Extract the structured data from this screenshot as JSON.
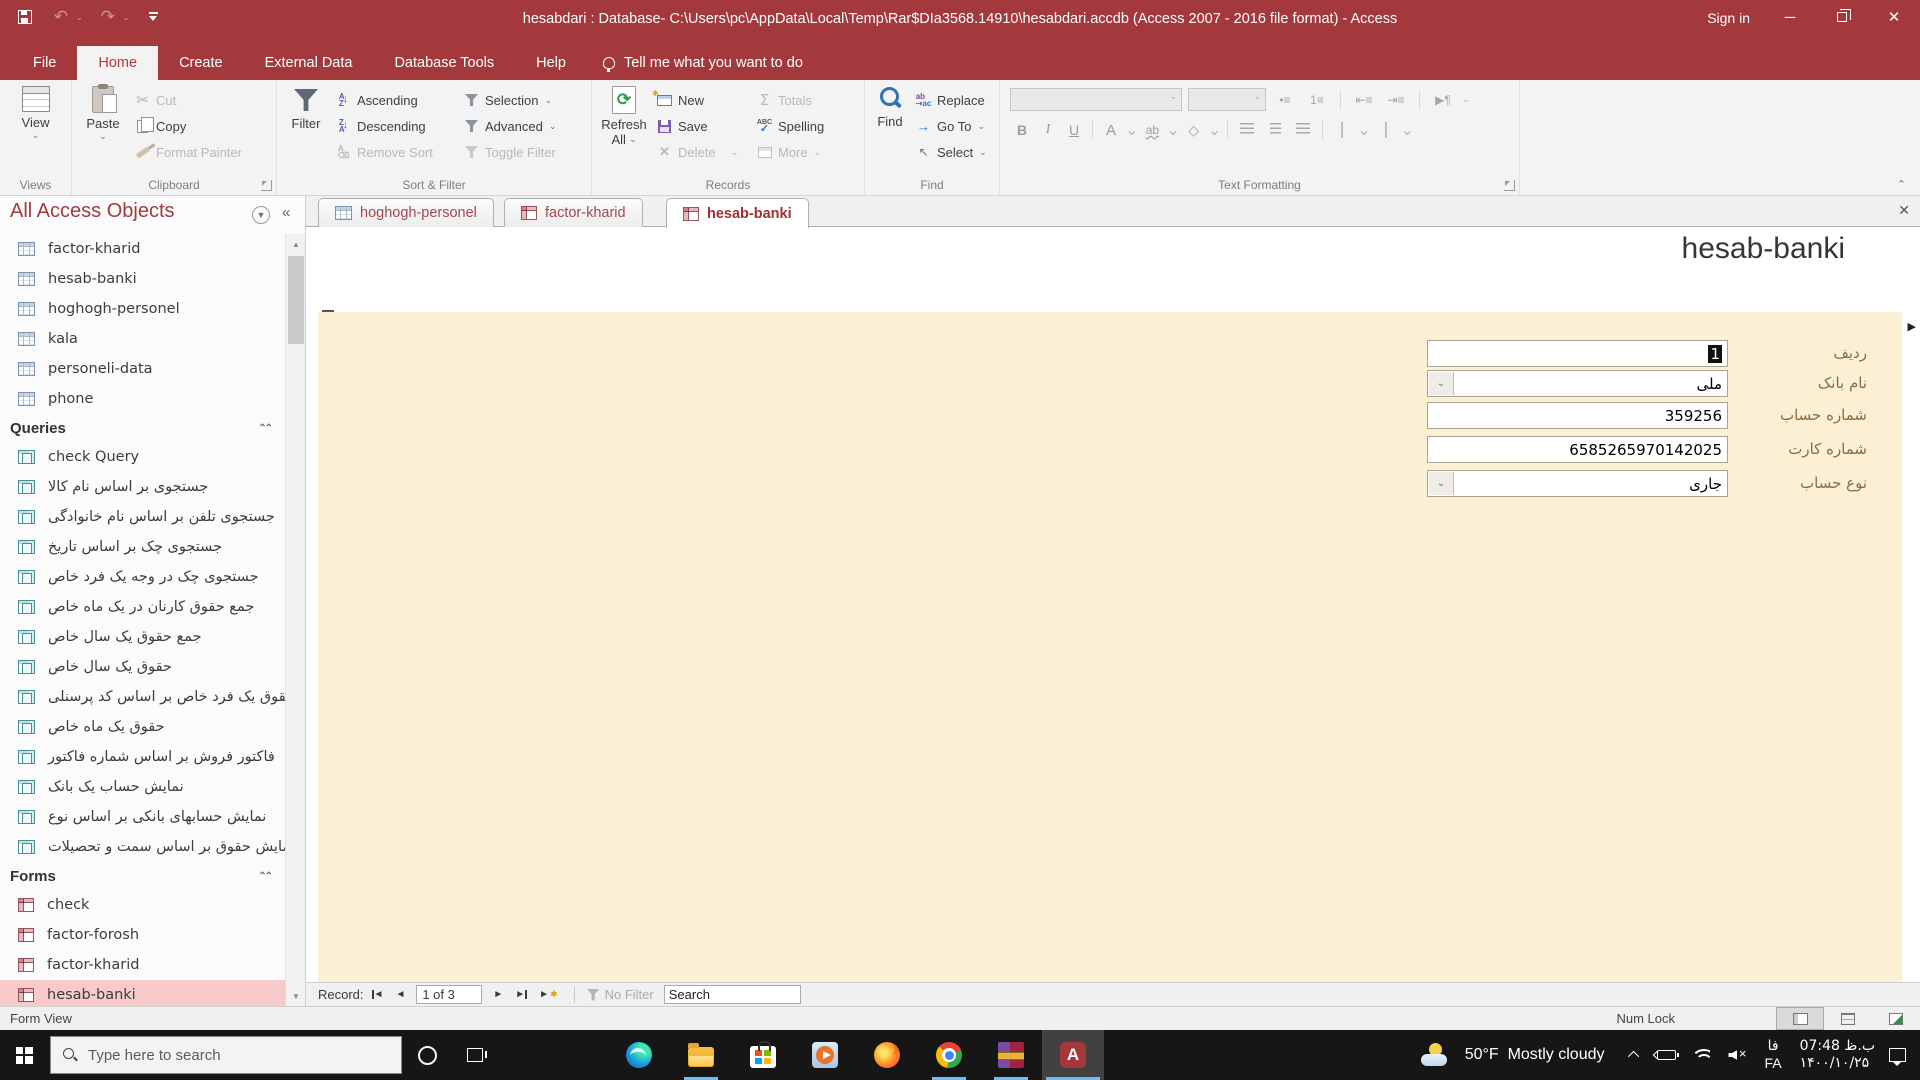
{
  "titlebar": {
    "title": "hesabdari : Database- C:\\Users\\pc\\AppData\\Local\\Temp\\Rar$DIa3568.14910\\hesabdari.accdb (Access 2007 - 2016 file format)  -  Access",
    "sign_in": "Sign in"
  },
  "menu": {
    "items": [
      {
        "label": "File",
        "active": false
      },
      {
        "label": "Home",
        "active": true
      },
      {
        "label": "Create",
        "active": false
      },
      {
        "label": "External Data",
        "active": false
      },
      {
        "label": "Database Tools",
        "active": false
      },
      {
        "label": "Help",
        "active": false
      }
    ],
    "tell_me": "Tell me what you want to do"
  },
  "ribbon": {
    "groups": {
      "views": "Views",
      "clipboard": "Clipboard",
      "sort_filter": "Sort & Filter",
      "records": "Records",
      "find": "Find",
      "text_formatting": "Text Formatting"
    },
    "buttons": {
      "view": "View",
      "paste": "Paste",
      "cut": "Cut",
      "copy": "Copy",
      "format_painter": "Format Painter",
      "filter": "Filter",
      "ascending": "Ascending",
      "descending": "Descending",
      "remove_sort": "Remove Sort",
      "selection": "Selection",
      "advanced": "Advanced",
      "toggle_filter": "Toggle Filter",
      "refresh": "Refresh",
      "refresh_all": "All",
      "new": "New",
      "save": "Save",
      "delete": "Delete",
      "totals": "Totals",
      "spelling": "Spelling",
      "more": "More",
      "find": "Find",
      "replace": "Replace",
      "go_to": "Go To",
      "select": "Select"
    },
    "tf_glyphs": {
      "bold": "B",
      "italic": "I",
      "underline": "U",
      "font_color": "A",
      "highlight": "ab",
      "fill": "◇",
      "direction": "▶¶",
      "bullets": "•≡",
      "numbering": "1≡",
      "outdent": "⇤≡",
      "indent": "⇥≡"
    }
  },
  "nav_pane": {
    "title": "All Access Objects",
    "sections": [
      {
        "header": null,
        "type": "table",
        "items": [
          "factor-kharid",
          "hesab-banki",
          "hoghogh-personel",
          "kala",
          "personeli-data",
          "phone"
        ]
      },
      {
        "header": "Queries",
        "type": "query",
        "items": [
          "check Query",
          "جستجوی بر اساس نام کالا",
          "جستجوی تلفن بر اساس نام خانوادگی",
          "جستجوی چک بر اساس تاریخ",
          "جستجوی چک در وجه یک فرد خاص",
          "جمع حقوق کارنان در یک ماه خاص",
          "جمع حقوق یک سال خاص",
          "حقوق یک سال خاص",
          "حقوق یک فرد خاص بر اساس کد پرسنلی",
          "حقوق یک ماه خاص",
          "فاکتور فروش بر اساس شماره فاکتور",
          "نمایش حساب یک بانک",
          "نمایش حسابهای بانکی بر اساس نوع",
          "نمایش حقوق بر اساس سمت و تحصیلات"
        ]
      },
      {
        "header": "Forms",
        "type": "form",
        "items": [
          "check",
          "factor-forosh",
          "factor-kharid",
          "hesab-banki"
        ],
        "selected": "hesab-banki"
      }
    ]
  },
  "tabs": [
    {
      "label": "hoghogh-personel",
      "type": "table",
      "active": false
    },
    {
      "label": "factor-kharid",
      "type": "form",
      "active": false
    },
    {
      "label": "hesab-banki",
      "type": "form",
      "active": true
    }
  ],
  "form": {
    "title": "hesab-banki",
    "fields": [
      {
        "label": "ردیف",
        "value": "1",
        "type": "text",
        "selected": true
      },
      {
        "label": "نام بانک",
        "value": "ملی",
        "type": "combo",
        "selected": false
      },
      {
        "label": "شماره حساب",
        "value": "359256",
        "type": "text",
        "selected": false
      },
      {
        "label": "شماره کارت",
        "value": "6585265970142025",
        "type": "text",
        "selected": false
      },
      {
        "label": "نوع حساب",
        "value": "جاری",
        "type": "combo",
        "selected": false
      }
    ]
  },
  "record_nav": {
    "record_label": "Record:",
    "position": "1 of 3",
    "no_filter": "No Filter",
    "search_placeholder": "Search"
  },
  "status_bar": {
    "left": "Form View",
    "num_lock": "Num Lock"
  },
  "taskbar": {
    "search_placeholder": "Type here to search",
    "apps": [
      {
        "id": "edge",
        "running": false,
        "active": false
      },
      {
        "id": "file-explorer",
        "running": true,
        "active": false
      },
      {
        "id": "microsoft-store",
        "running": false,
        "active": false
      },
      {
        "id": "media-player",
        "running": false,
        "active": false
      },
      {
        "id": "firefox",
        "running": false,
        "active": false
      },
      {
        "id": "chrome",
        "running": true,
        "active": false
      },
      {
        "id": "winrar",
        "running": true,
        "active": false
      },
      {
        "id": "access",
        "running": true,
        "active": true
      }
    ],
    "weather_temp": "50°F",
    "weather_desc": "Mostly cloudy",
    "lang_top": "فا",
    "lang_bottom": "FA",
    "time_top": "ب.ظ 07:48",
    "date_bottom": "۱۴۰۰/۱۰/۲۵"
  },
  "colors": {
    "accent_red": "#a4393d",
    "form_beige": "#fbf0d3",
    "selection_pink": "#f8caca",
    "running_underline": "#76b9ed"
  }
}
